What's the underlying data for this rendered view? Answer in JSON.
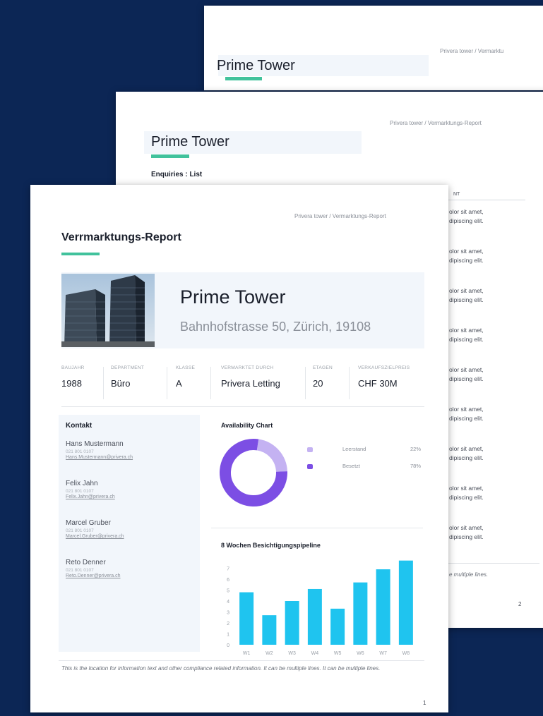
{
  "pages": {
    "back": {
      "breadcrumb": "Privera tower / Vermarktu",
      "title": "Prime Tower"
    },
    "middle": {
      "breadcrumb": "Privera tower / Vermarktungs-Report",
      "title": "Prime Tower",
      "subtitle": "Enquiries : List",
      "column_header": "NT",
      "rows": [
        [
          "olor sit amet,",
          "dipiscing elit."
        ],
        [
          "olor sit amet,",
          "dipiscing elit."
        ],
        [
          "olor sit amet,",
          "dipiscing elit."
        ],
        [
          "olor sit amet,",
          "dipiscing elit."
        ],
        [
          "olor sit amet,",
          "dipiscing elit."
        ],
        [
          "olor sit amet,",
          "dipiscing elit."
        ],
        [
          "olor sit amet,",
          "dipiscing elit."
        ],
        [
          "olor sit amet,",
          "dipiscing elit."
        ],
        [
          "olor sit amet,",
          "dipiscing elit."
        ]
      ],
      "footnote": "e multiple lines.",
      "page_number": "2"
    },
    "front": {
      "breadcrumb": "Privera tower / Vermarktungs-Report",
      "report_title": "Verrmarktungs-Report",
      "property_name": "Prime Tower",
      "address": "Bahnhofstrasse 50, Zürich, 19108",
      "stats": [
        {
          "label": "BAUJAHR",
          "value": "1988"
        },
        {
          "label": "DEPARTMENT",
          "value": "Büro"
        },
        {
          "label": "KLASSE",
          "value": "A"
        },
        {
          "label": "VERMARKTET DURCH",
          "value": "Privera Letting"
        },
        {
          "label": "ETAGEN",
          "value": "20"
        },
        {
          "label": "VERKAUFSZIELPREIS",
          "value": "CHF 30M"
        }
      ],
      "contacts_header": "Kontakt",
      "contacts": [
        {
          "name": "Hans Mustermann",
          "phone": "021 801 0107",
          "email": "Hans.Mustermann@privera.ch"
        },
        {
          "name": "Felix Jahn",
          "phone": "021 801 0107",
          "email": "Felix.Jahn@privera.ch"
        },
        {
          "name": "Marcel Gruber",
          "phone": "021 801 0107",
          "email": "Marcel.Gruber@privera.ch"
        },
        {
          "name": "Reto Denner",
          "phone": "021 801 0107",
          "email": "Reto.Denner@privera.ch"
        }
      ],
      "footnote": "This is the location for information text and other compliance related information. It can be multiple lines. It can be multiple lines.",
      "page_number": "1"
    }
  },
  "colors": {
    "background": "#0c2655",
    "accent": "#41c29c",
    "vacant": "#c4b2f2",
    "occupied": "#7c4ee4",
    "bar": "#1fc4ef",
    "panel": "#f2f6fb"
  },
  "chart_data": [
    {
      "type": "pie",
      "title": "Availability Chart",
      "style": "donut",
      "labels": [
        "Leerstand",
        "Besetzt"
      ],
      "values": [
        22,
        78
      ],
      "value_labels": [
        "22%",
        "78%"
      ]
    },
    {
      "type": "bar",
      "title": "8 Wochen Besichtigungspipeline",
      "categories": [
        "W1",
        "W2",
        "W3",
        "W4",
        "W5",
        "W6",
        "W7",
        "W8"
      ],
      "values": [
        4.8,
        2.7,
        4.0,
        5.1,
        3.3,
        5.7,
        6.9,
        7.7
      ],
      "yticks": [
        0,
        1,
        2,
        3,
        4,
        5,
        6,
        7
      ],
      "ylim": [
        0,
        8
      ],
      "grid": false
    }
  ]
}
